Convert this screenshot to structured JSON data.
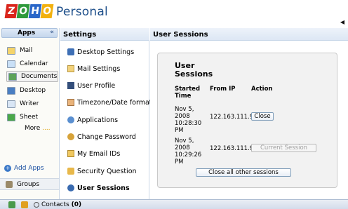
{
  "brand": {
    "logo_letters": [
      "Z",
      "O",
      "H",
      "O"
    ],
    "logo_colors": [
      "#d9251c",
      "#2f9a3c",
      "#2a67c9",
      "#f2b10f"
    ],
    "product": "Personal"
  },
  "apps": {
    "header": "Apps",
    "collapse": "«",
    "items": [
      {
        "label": "Mail",
        "icon": "mail-icon",
        "color": "#f5d46a"
      },
      {
        "label": "Calendar",
        "icon": "calendar-icon",
        "color": "#c9e0f7"
      },
      {
        "label": "Documents",
        "icon": "documents-icon",
        "color": "#5da35a"
      },
      {
        "label": "Desktop",
        "icon": "desktop-icon",
        "color": "#4a7ec2"
      },
      {
        "label": "Writer",
        "icon": "writer-icon",
        "color": "#d9e6f5"
      },
      {
        "label": "Sheet",
        "icon": "sheet-icon",
        "color": "#4aa84a"
      }
    ],
    "more": "More",
    "more_dots": "....",
    "add_apps": "Add Apps",
    "groups": "Groups"
  },
  "settings": {
    "header": "Settings",
    "items": [
      {
        "label": "Desktop Settings",
        "icon": "desktop-settings-icon",
        "color": "#3e6fb5"
      },
      {
        "label": "Mail Settings",
        "icon": "mail-settings-icon",
        "color": "#f3d27a"
      },
      {
        "label": "User Profile",
        "icon": "user-profile-icon",
        "color": "#334e7a"
      },
      {
        "label": "Timezone/Date format",
        "icon": "timezone-icon",
        "color": "#e9b37a"
      },
      {
        "label": "Applications",
        "icon": "applications-icon",
        "color": "#5a8fd0"
      },
      {
        "label": "Change Password",
        "icon": "key-icon",
        "color": "#d7a33a"
      },
      {
        "label": "My Email IDs",
        "icon": "email-ids-icon",
        "color": "#f0c860"
      },
      {
        "label": "Security Question",
        "icon": "security-question-icon",
        "color": "#e8b84a"
      },
      {
        "label": "User Sessions",
        "icon": "user-sessions-icon",
        "color": "#3a6bb0"
      }
    ]
  },
  "main": {
    "header": "User Sessions",
    "box_title": "User Sessions",
    "columns": {
      "started": "Started Time",
      "ip": "From IP",
      "action": "Action"
    },
    "sessions": [
      {
        "time": "Nov 5, 2008 10:28:30 PM",
        "ip": "122.163.111.9",
        "action": "Close"
      },
      {
        "time": "Nov 5, 2008 10:29:26 PM",
        "ip": "122.163.111.9",
        "action": "Current Session"
      }
    ],
    "close_all": "Close all other sessions"
  },
  "statusbar": {
    "contacts_label": "Contacts",
    "contacts_count": "(0)"
  }
}
